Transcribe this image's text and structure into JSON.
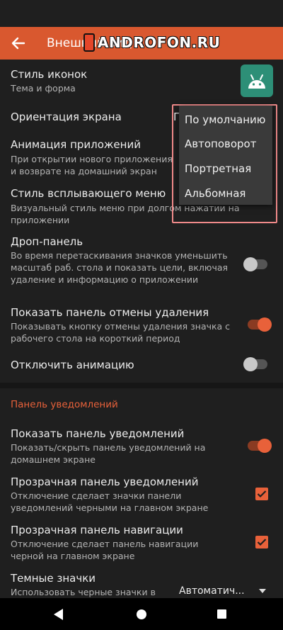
{
  "appbar": {
    "title": "Внешний вид"
  },
  "watermark": {
    "text": "ANDROFON.RU"
  },
  "rows": [
    {
      "title": "Стиль иконок",
      "subtitle": "Тема и форма"
    },
    {
      "title": "Ориентация экрана",
      "value_peek": "П"
    },
    {
      "title": "Анимация приложений",
      "subtitle": "При открытии нового приложения и возврате на домашний экран"
    },
    {
      "title": "Стиль всплывающего меню",
      "subtitle": "Визуальный стиль меню при долгом нажатии на приложении"
    },
    {
      "title": "Дроп-панель",
      "subtitle": "Во время перетаскивания значков уменьшить масштаб раб. стола и показать цели, включая удаление и информацию о приложении",
      "toggle": "off"
    },
    {
      "title": "Показать панель отмены удаления",
      "subtitle": "Показывать кнопку отмены удаления значка с рабочего стола на короткий период",
      "toggle": "on"
    },
    {
      "title": "Отключить анимацию",
      "toggle": "off"
    }
  ],
  "section": {
    "header": "Панель уведомлений"
  },
  "notif_rows": [
    {
      "title": "Показать панель уведомлений",
      "subtitle": "Показать/скрыть панель уведомлений на домашнем экране",
      "toggle": "on"
    },
    {
      "title": "Прозрачная панель уведомлений",
      "subtitle": "Отключение сделает значки панели уведомлений черными на главном экране",
      "checked": true
    },
    {
      "title": "Прозрачная панель навигации",
      "subtitle": "Отключение сделает панель навигации черной на главном экране",
      "checked": true
    },
    {
      "title": "Темные значки",
      "subtitle": "Использовать черные значки в панели уведомлений на главном экране",
      "select_value": "Автоматич..."
    }
  ],
  "orientation_menu": {
    "options": [
      "По умолчанию",
      "Автоповорот",
      "Портретная",
      "Альбомная"
    ]
  },
  "colors": {
    "accent": "#e8613a",
    "appbar": "#d9582f",
    "background": "#1f1f1f",
    "highlight": "#f08a8a"
  },
  "icons": [
    "back-arrow-icon",
    "android-icon",
    "check-icon",
    "nav-back-icon",
    "nav-home-icon",
    "nav-recents-icon"
  ]
}
